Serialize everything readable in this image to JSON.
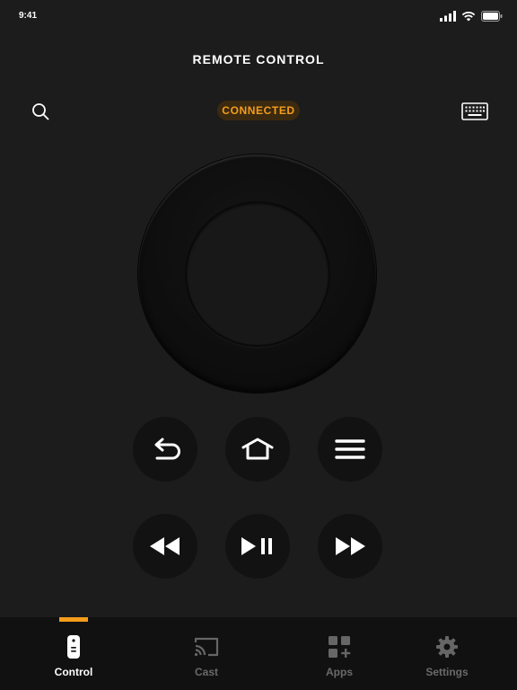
{
  "status_bar": {
    "time": "9:41"
  },
  "header": {
    "title": "REMOTE CONTROL"
  },
  "connection": {
    "status_label": "CONNECTED",
    "accent_color": "#f59d1b"
  },
  "icons": {
    "search": "search-icon",
    "keyboard": "keyboard-icon",
    "back": "back-icon",
    "home": "home-icon",
    "menu": "menu-icon",
    "rewind": "rewind-icon",
    "play_pause": "play-pause-icon",
    "fast_forward": "fast-forward-icon"
  },
  "tabs": [
    {
      "label": "Control",
      "icon": "remote-icon",
      "active": true
    },
    {
      "label": "Cast",
      "icon": "cast-icon",
      "active": false
    },
    {
      "label": "Apps",
      "icon": "apps-icon",
      "active": false
    },
    {
      "label": "Settings",
      "icon": "gear-icon",
      "active": false
    }
  ]
}
